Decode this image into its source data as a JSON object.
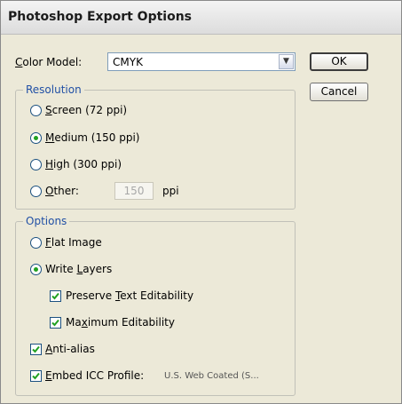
{
  "dialog": {
    "title": "Photoshop Export Options"
  },
  "color_model": {
    "label_prefix": "",
    "label_mnemonic": "C",
    "label_rest": "olor Model:",
    "value": "CMYK"
  },
  "buttons": {
    "ok": "OK",
    "cancel": "Cancel"
  },
  "resolution": {
    "legend": "Resolution",
    "screen": {
      "m": "S",
      "rest": "creen (72 ppi)",
      "selected": false
    },
    "medium": {
      "m": "M",
      "rest": "edium (150 ppi)",
      "selected": true
    },
    "high": {
      "m": "H",
      "rest": "igh (300 ppi)",
      "selected": false
    },
    "other": {
      "m": "O",
      "rest": "ther:",
      "selected": false,
      "value": "150",
      "unit": "ppi"
    }
  },
  "options": {
    "legend": "Options",
    "flat_image": {
      "m": "F",
      "rest": "lat Image",
      "selected": false
    },
    "write_layers": {
      "pre": "Write ",
      "m": "L",
      "rest": "ayers",
      "selected": true
    },
    "preserve_text": {
      "pre": "Preserve ",
      "m": "T",
      "rest": "ext Editability",
      "checked": true
    },
    "max_edit": {
      "pre": "Ma",
      "m": "x",
      "rest": "imum Editability",
      "checked": true
    },
    "anti_alias": {
      "m": "A",
      "rest": "nti-alias",
      "checked": true
    },
    "embed_icc": {
      "m": "E",
      "rest": "mbed ICC Profile:",
      "checked": true,
      "profile": "U.S. Web Coated (S..."
    }
  }
}
